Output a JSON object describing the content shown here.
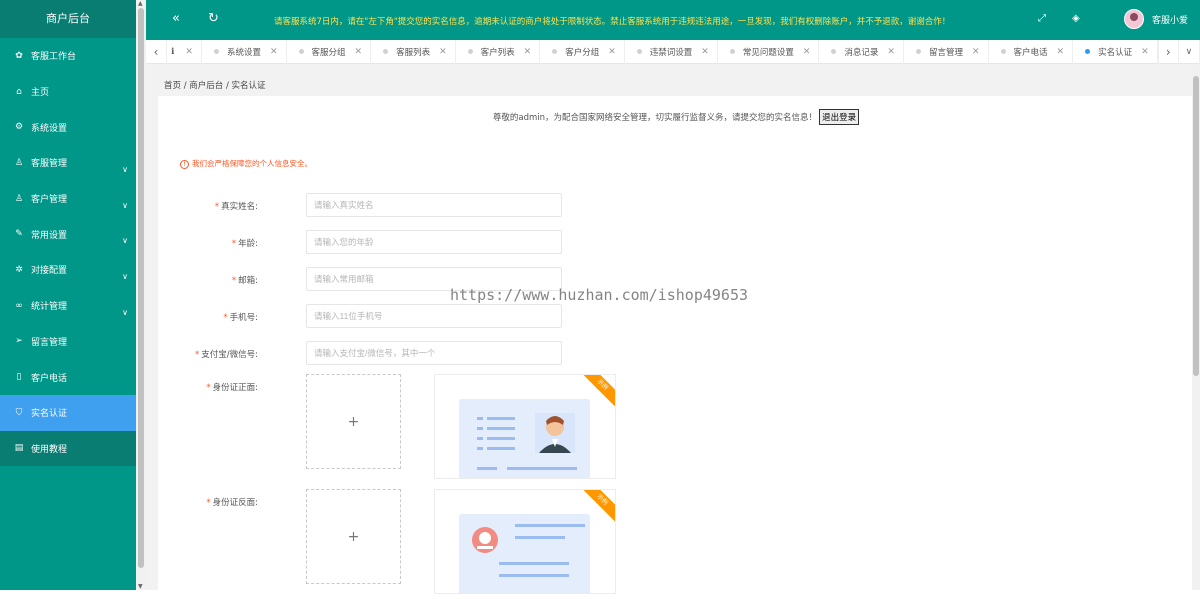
{
  "sidebar": {
    "title": "商户后台",
    "items": [
      {
        "label": "客服工作台",
        "icon": "dashboard-icon"
      },
      {
        "label": "主页",
        "icon": "home-icon"
      },
      {
        "label": "系统设置",
        "icon": "gear-icon"
      },
      {
        "label": "客服管理",
        "icon": "user-icon"
      },
      {
        "label": "客户管理",
        "icon": "users-icon"
      },
      {
        "label": "常用设置",
        "icon": "edit-icon"
      },
      {
        "label": "对接配置",
        "icon": "settings-icon"
      },
      {
        "label": "统计管理",
        "icon": "chart-icon"
      },
      {
        "label": "留言管理",
        "icon": "send-icon"
      },
      {
        "label": "客户电话",
        "icon": "phone-icon"
      },
      {
        "label": "实名认证",
        "icon": "shield-icon"
      },
      {
        "label": "使用教程",
        "icon": "book-icon"
      }
    ]
  },
  "topbar": {
    "notice": "请客服系统7日内，请在\"左下角\"提交您的实名信息，逾期未认证的商户将处于限制状态。禁止客服系统用于违规违法用途，一旦发现，我们有权删除账户，并不予退款，谢谢合作！",
    "username": "客服小爱"
  },
  "tabs": [
    {
      "label": "",
      "active": false
    },
    {
      "label": "系统设置",
      "active": false
    },
    {
      "label": "客服分组",
      "active": false
    },
    {
      "label": "客服列表",
      "active": false
    },
    {
      "label": "客户列表",
      "active": false
    },
    {
      "label": "客户分组",
      "active": false
    },
    {
      "label": "违禁词设置",
      "active": false
    },
    {
      "label": "常见问题设置",
      "active": false
    },
    {
      "label": "消息记录",
      "active": false
    },
    {
      "label": "留言管理",
      "active": false
    },
    {
      "label": "客户电话",
      "active": false
    },
    {
      "label": "实名认证",
      "active": true
    }
  ],
  "breadcrumb": "首页 / 商户后台 / 实名认证",
  "welcome": "尊敬的admin，为配合国家网络安全管理，切实履行监督义务，请提交您的实名信息！",
  "logout_label": "退出登录",
  "tip": "我们会严格保障您的个人信息安全。",
  "form": {
    "name": {
      "label": "真实姓名:",
      "placeholder": "请输入真实姓名"
    },
    "age": {
      "label": "年龄:",
      "placeholder": "请输入您的年龄"
    },
    "email": {
      "label": "邮箱:",
      "placeholder": "请输入常用邮箱"
    },
    "phone": {
      "label": "手机号:",
      "placeholder": "请输入11位手机号"
    },
    "pay": {
      "label": "支付宝/微信号:",
      "placeholder": "请输入支付宝/微信号，其中一个"
    },
    "id_front": {
      "label": "身份证正面:"
    },
    "id_back": {
      "label": "身份证反面:"
    },
    "sample_badge": "示例",
    "upload_plus": "+"
  },
  "watermark": "https://www.huzhan.com/ishop49653",
  "colors": {
    "primary": "#009688",
    "active": "#40a0f0",
    "notice": "#ffe14d",
    "warn": "#ff5722",
    "ribbon": "#ff9800"
  }
}
